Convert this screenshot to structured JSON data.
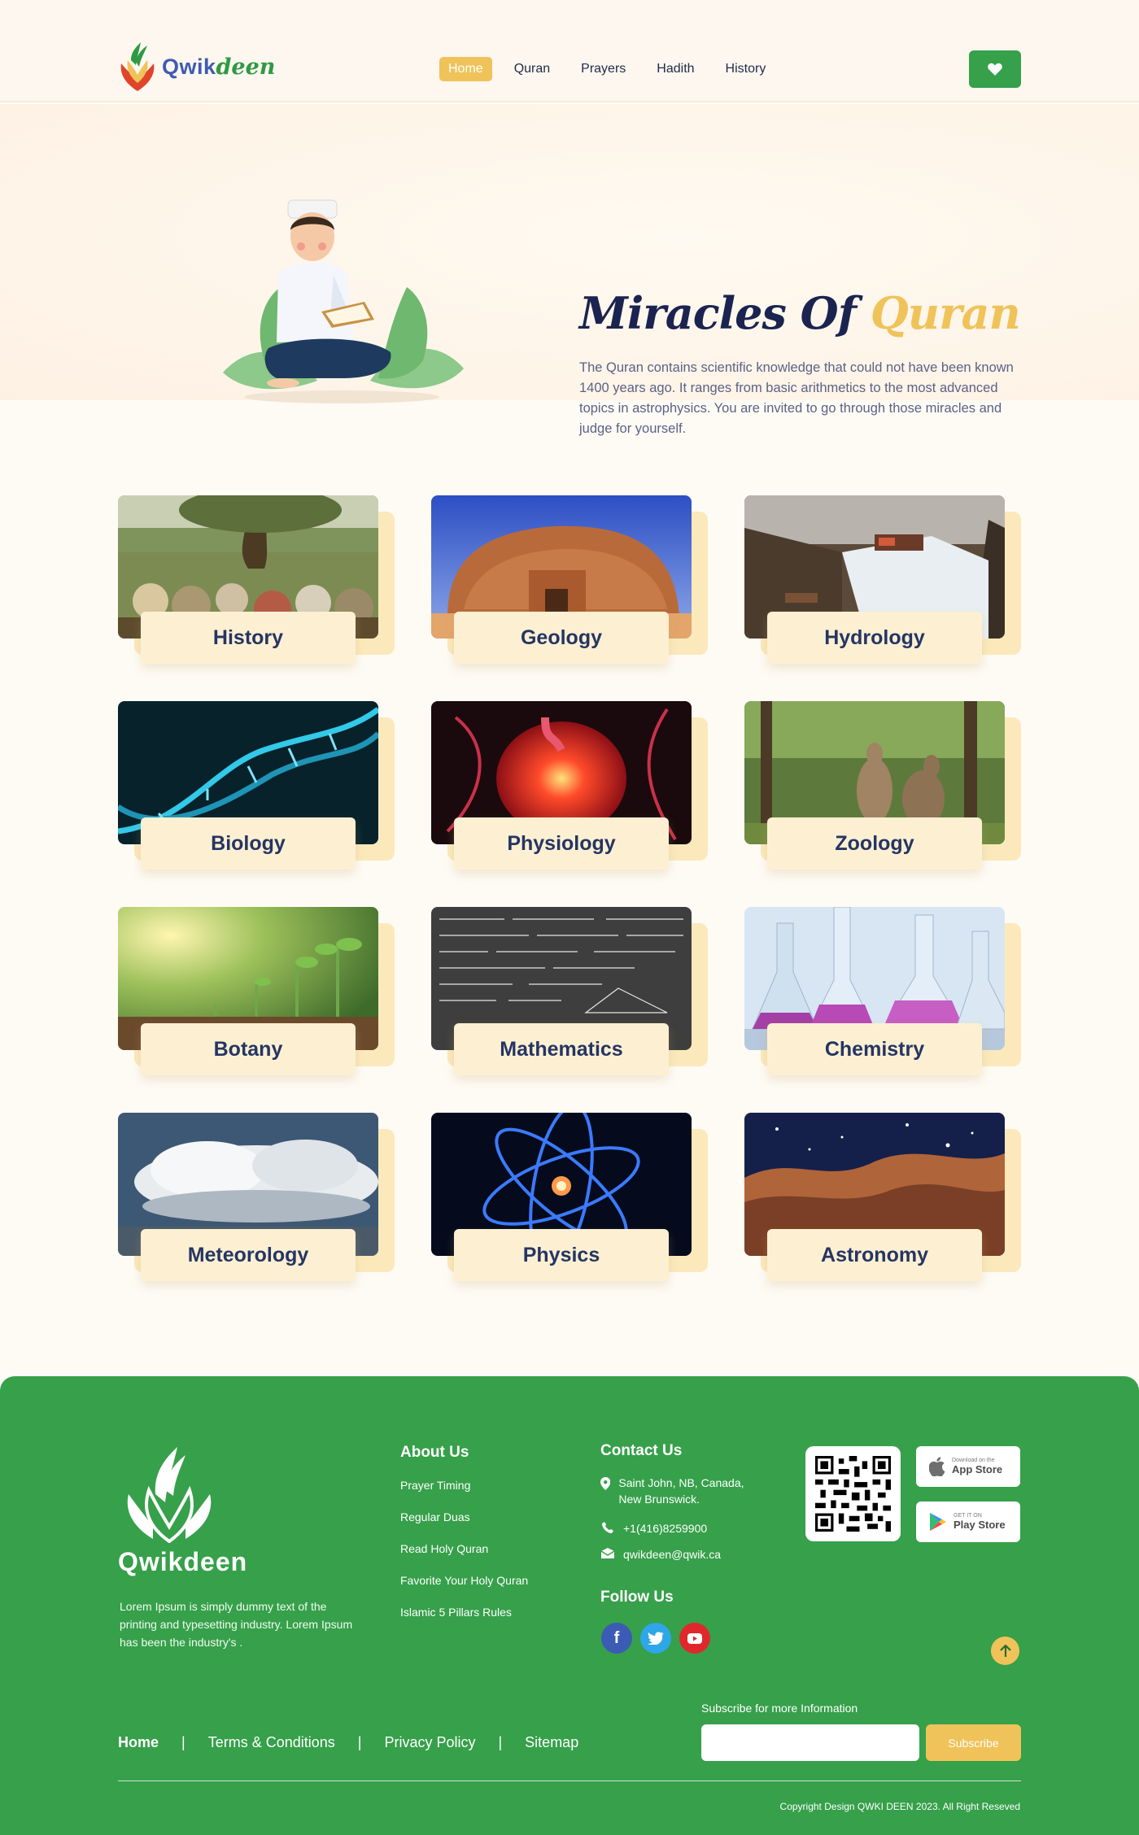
{
  "header": {
    "brand_part1": "Qwik",
    "brand_part2": "deen",
    "nav": [
      "Home",
      "Quran",
      "Prayers",
      "Hadith",
      "History"
    ],
    "active_nav": "Home",
    "favorite_icon": "heart-icon"
  },
  "hero": {
    "title_part1": "Miracles Of",
    "title_part2": "Quran",
    "description": "The Quran contains scientific knowledge that could not have been known 1400 years ago. It ranges from basic arithmetics to the most advanced topics in astrophysics. You are invited to go through those miracles and judge for yourself."
  },
  "categories": [
    "History",
    "Geology",
    "Hydrology",
    "Biology",
    "Physiology",
    "Zoology",
    "Botany",
    "Mathematics",
    "Chemistry",
    "Meteorology",
    "Physics",
    "Astronomy"
  ],
  "footer": {
    "brand": "Qwikdeen",
    "description": "Lorem Ipsum is simply dummy text of the printing and typesetting industry.  Lorem Ipsum has been the industry's .",
    "about_heading": "About Us",
    "about_links": [
      "Prayer Timing",
      "Regular Duas",
      "Read Holy Quran",
      "Favorite Your Holy Quran",
      "Islamic 5 Pillars Rules"
    ],
    "contact_heading": "Contact Us",
    "address": "Saint John, NB, Canada, New Brunswick.",
    "phone": "+1(416)8259900",
    "email": "qwikdeen@qwik.ca",
    "follow_heading": "Follow Us",
    "app_store_small": "Download on the",
    "app_store": "App Store",
    "play_store_small": "GET IT ON",
    "play_store": "Play Store",
    "subscribe_label": "Subscribe for more Information",
    "subscribe_button": "Subscribe",
    "bottom_nav": [
      "Home",
      "Terms & Conditions",
      "Privacy Policy",
      "Sitemap"
    ],
    "copyright": "Copyright Design QWKI DEEN 2023.  All Right Reseved"
  },
  "colors": {
    "brand_green": "#36a04a",
    "accent_gold": "#f0c35a",
    "navy": "#1b2450"
  }
}
